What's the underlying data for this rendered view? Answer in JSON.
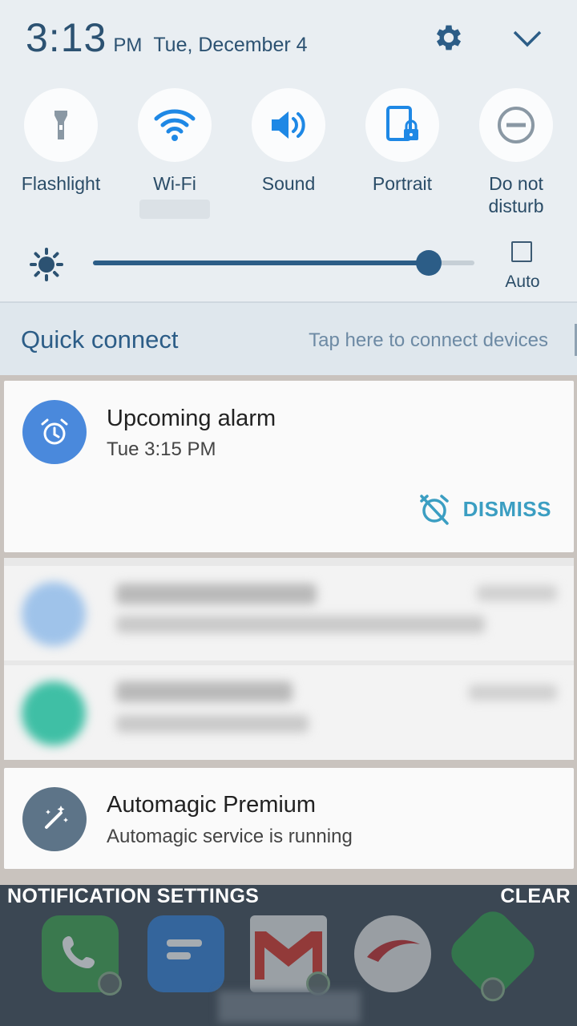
{
  "status": {
    "time": "3:13",
    "ampm": "PM",
    "date": "Tue, December 4"
  },
  "quick_settings": {
    "tiles": [
      {
        "id": "flashlight",
        "label": "Flashlight",
        "icon": "flashlight-icon",
        "active": false
      },
      {
        "id": "wifi",
        "label": "Wi-Fi",
        "icon": "wifi-icon",
        "active": true
      },
      {
        "id": "sound",
        "label": "Sound",
        "icon": "sound-icon",
        "active": true
      },
      {
        "id": "portrait",
        "label": "Portrait",
        "icon": "portrait-lock-icon",
        "active": true
      },
      {
        "id": "dnd",
        "label": "Do not disturb",
        "icon": "do-not-disturb-icon",
        "active": false
      }
    ],
    "brightness_level": 0.88,
    "auto_label": "Auto",
    "auto_checked": false
  },
  "quick_connect": {
    "title": "Quick connect",
    "hint": "Tap here to connect devices"
  },
  "notifications": {
    "alarm": {
      "title": "Upcoming alarm",
      "text": "Tue 3:15 PM",
      "action": "DISMISS"
    },
    "automagic": {
      "title": "Automagic Premium",
      "text": "Automagic service is running"
    }
  },
  "footer": {
    "settings": "NOTIFICATION SETTINGS",
    "clear": "CLEAR"
  },
  "colors": {
    "accent": "#2c5d87",
    "tile_active": "#1e88e5",
    "tile_inactive": "#8a98a4",
    "dismiss": "#3b9ec2"
  }
}
